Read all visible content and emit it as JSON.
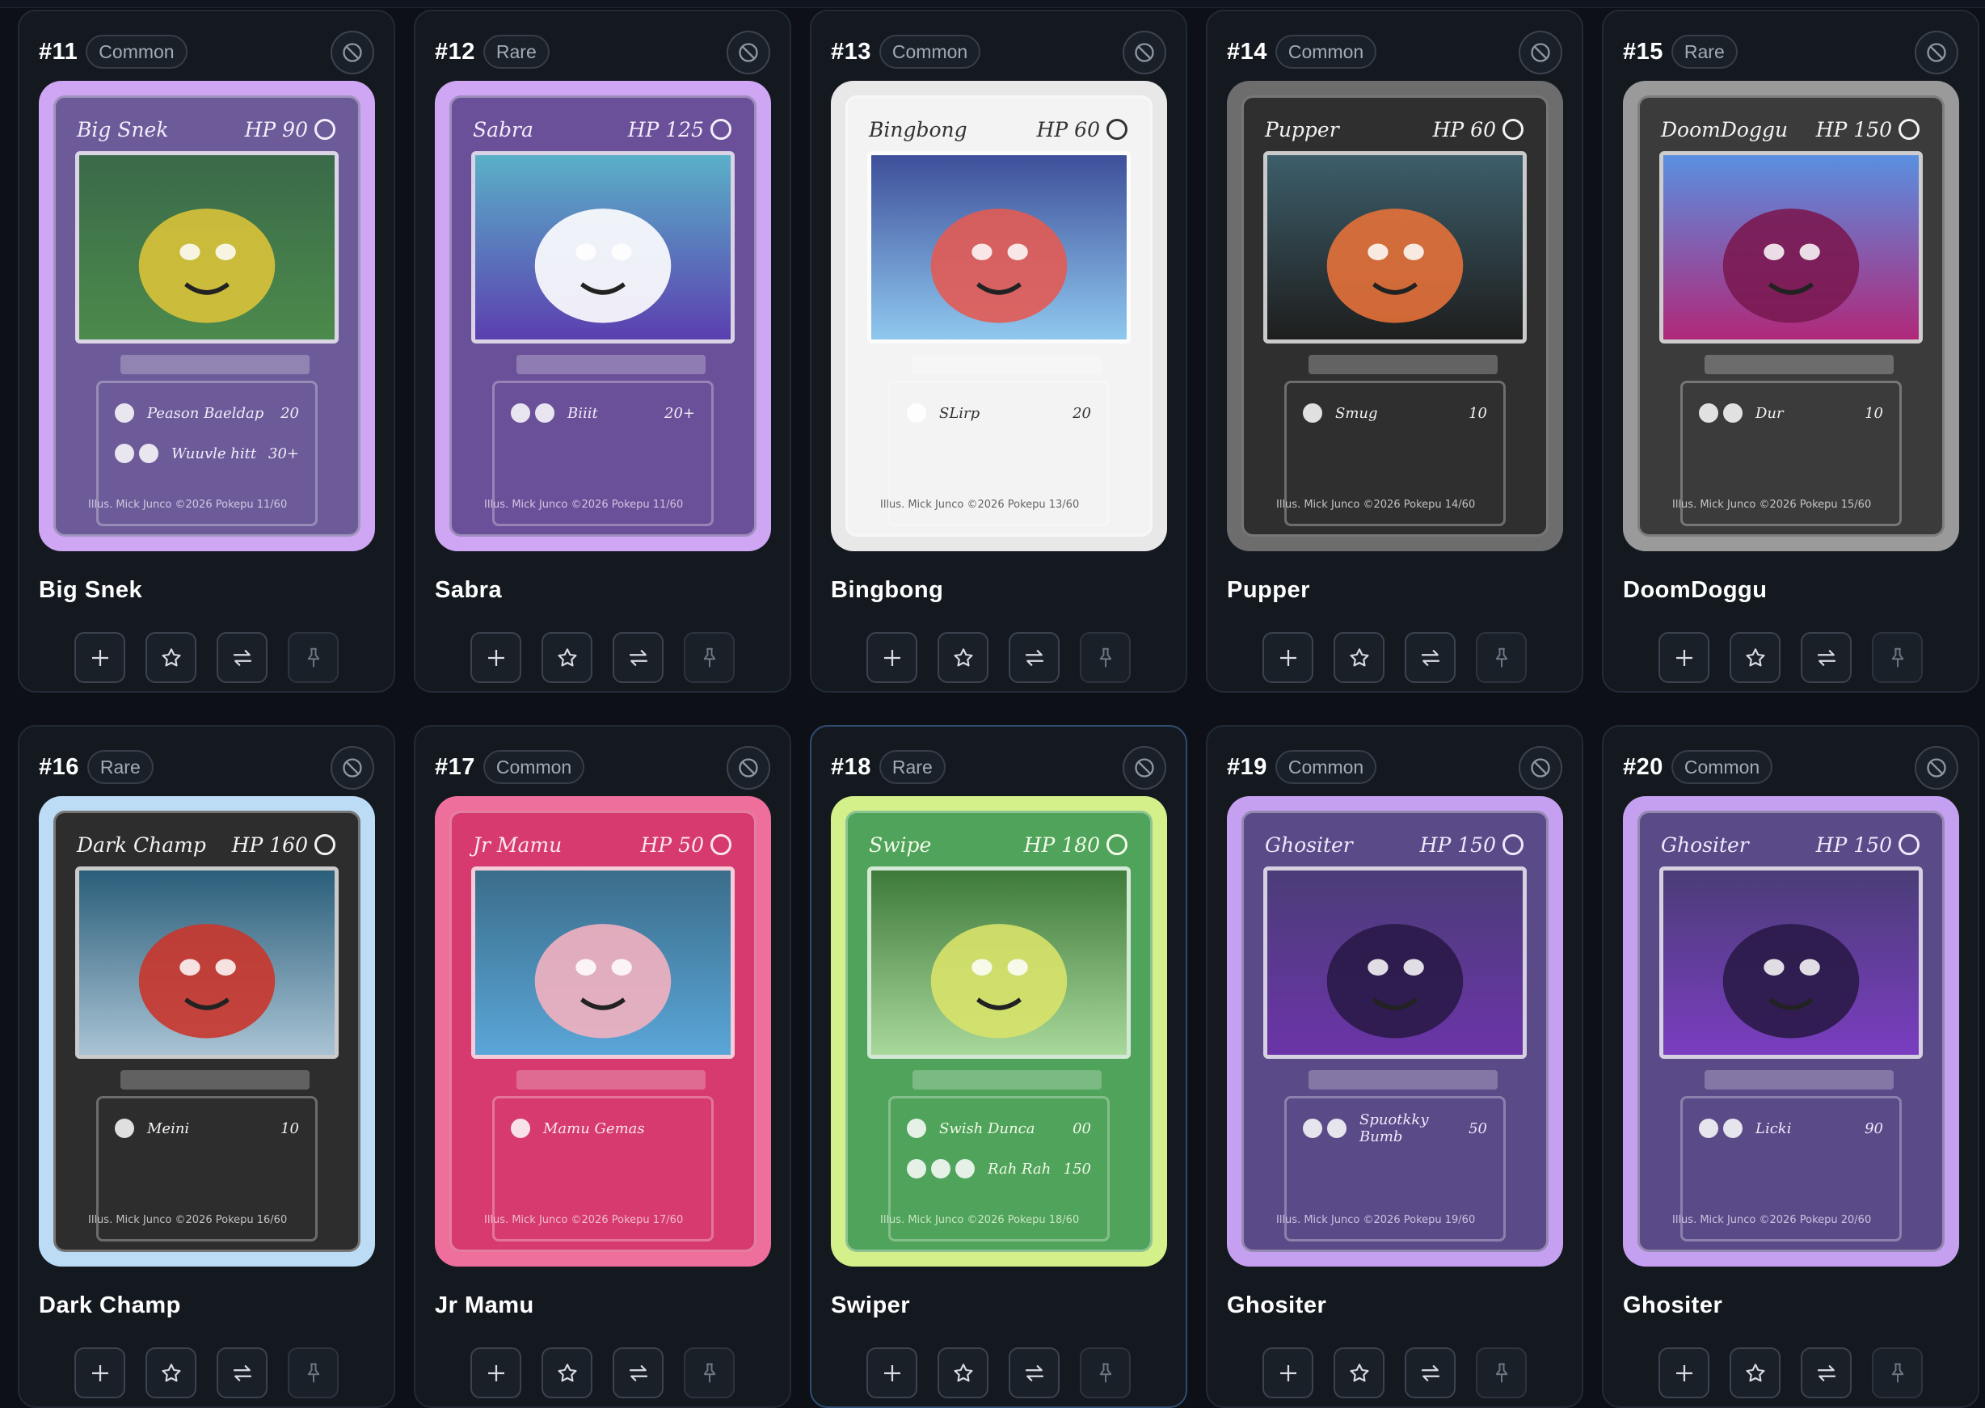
{
  "cards": [
    {
      "number": "#11",
      "rarity": "Common",
      "name": "Big Snek",
      "card_title": "Big Snek",
      "hp": "HP 90",
      "frame_color": "#cfa6f4",
      "panel_color": "#6c5b98",
      "text_color": "#f2ecfb",
      "art_colors": [
        "#3a6a4a",
        "#4c8a4b",
        "#d9c23a"
      ],
      "moves": [
        {
          "name": "Peason Baeldap",
          "damage": "20",
          "cost": 1
        },
        {
          "name": "Wuuvle hitt",
          "damage": "30+",
          "cost": 2
        }
      ],
      "footer": "Illus. Mick Junco  ©2026 Pokepu  11/60"
    },
    {
      "number": "#12",
      "rarity": "Rare",
      "name": "Sabra",
      "card_title": "Sabra",
      "hp": "HP 125",
      "frame_color": "#cfa6f4",
      "panel_color": "#6a5098",
      "text_color": "#f2ecfb",
      "art_colors": [
        "#5ab0c8",
        "#5b3fb0",
        "#ffffff"
      ],
      "moves": [
        {
          "name": "Biiit",
          "damage": "20+",
          "cost": 2
        }
      ],
      "footer": "Illus. Mick Junco  ©2026 Pokepu  11/60"
    },
    {
      "number": "#13",
      "rarity": "Common",
      "name": "Bingbong",
      "card_title": "Bingbong",
      "hp": "HP 60",
      "frame_color": "#e8e8e8",
      "panel_color": "#f3f3f3",
      "text_color": "#333333",
      "art_colors": [
        "#3e4f9a",
        "#8fc8ef",
        "#e25b54"
      ],
      "moves": [
        {
          "name": "SLirp",
          "damage": "20",
          "cost": 1
        }
      ],
      "footer": "Illus. Mick Junco  ©2026 Pokepu  13/60"
    },
    {
      "number": "#14",
      "rarity": "Common",
      "name": "Pupper",
      "card_title": "Pupper",
      "hp": "HP 60",
      "frame_color": "#6d6d6d",
      "panel_color": "#2f2f2f",
      "text_color": "#f2f2f2",
      "art_colors": [
        "#3c5e6a",
        "#1e1e1e",
        "#e4713a"
      ],
      "moves": [
        {
          "name": "Smug",
          "damage": "10",
          "cost": 1
        }
      ],
      "footer": "Illus. Mick Junco  ©2026 Pokepu  14/60"
    },
    {
      "number": "#15",
      "rarity": "Rare",
      "name": "DoomDoggu",
      "card_title": "DoomDoggu",
      "hp": "HP 150",
      "frame_color": "#9a9a9a",
      "panel_color": "#3b3b3b",
      "text_color": "#f2f2f2",
      "art_colors": [
        "#5a8fe0",
        "#b0287a",
        "#7a1a52"
      ],
      "moves": [
        {
          "name": "Dur",
          "damage": "10",
          "cost": 2
        }
      ],
      "footer": "Illus. Mick Junco  ©2026 Pokepu  15/60"
    },
    {
      "number": "#16",
      "rarity": "Rare",
      "name": "Dark Champ",
      "card_title": "Dark Champ",
      "hp": "HP 160",
      "frame_color": "#bcdcf6",
      "panel_color": "#2d2d2d",
      "text_color": "#f2f2f2",
      "art_colors": [
        "#2a5e7a",
        "#a9c3d4",
        "#c9362c"
      ],
      "moves": [
        {
          "name": "Meini",
          "damage": "10",
          "cost": 1
        }
      ],
      "footer": "Illus. Mick Junco  ©2026 Pokepu  16/60"
    },
    {
      "number": "#17",
      "rarity": "Common",
      "name": "Jr Mamu",
      "card_title": "Jr Mamu",
      "hp": "HP 50",
      "frame_color": "#ef6f9c",
      "panel_color": "#d63a6e",
      "text_color": "#fbe6ee",
      "art_colors": [
        "#3b6d8a",
        "#5aa6d8",
        "#f2b1c0"
      ],
      "moves": [
        {
          "name": "Mamu Gemas",
          "damage": "",
          "cost": 1
        }
      ],
      "footer": "Illus. Mick Junco  ©2026 Pokepu  17/60"
    },
    {
      "number": "#18",
      "rarity": "Rare",
      "name": "Swiper",
      "card_title": "Swipe",
      "hp": "HP 180",
      "frame_color": "#d4f08a",
      "panel_color": "#4fa35a",
      "text_color": "#f2fbe8",
      "art_colors": [
        "#3e7a3a",
        "#a8d89a",
        "#d8e26a"
      ],
      "moves": [
        {
          "name": "Swish Dunca",
          "damage": "00",
          "cost": 1
        },
        {
          "name": "Rah Rah",
          "damage": "150",
          "cost": 3
        }
      ],
      "footer": "Illus. Mick Junco  ©2026 Pokepu  18/60"
    },
    {
      "number": "#19",
      "rarity": "Common",
      "name": "Ghositer",
      "card_title": "Ghositer",
      "hp": "HP 150",
      "frame_color": "#c6a0f0",
      "panel_color": "#5b4a88",
      "text_color": "#efe8fb",
      "art_colors": [
        "#4b3d78",
        "#6b34a8",
        "#2a1a48"
      ],
      "moves": [
        {
          "name": "Spuotkky Bumb",
          "damage": "50",
          "cost": 2
        }
      ],
      "footer": "Illus. Mick Junco  ©2026 Pokepu  19/60"
    },
    {
      "number": "#20",
      "rarity": "Common",
      "name": "Ghositer",
      "card_title": "Ghositer",
      "hp": "HP 150",
      "frame_color": "#c6a0f0",
      "panel_color": "#5b4a88",
      "text_color": "#efe8fb",
      "art_colors": [
        "#4b3d78",
        "#7a3dc0",
        "#2a1a48"
      ],
      "moves": [
        {
          "name": "Licki",
          "damage": "90",
          "cost": 2
        }
      ],
      "footer": "Illus. Mick Junco  ©2026 Pokepu  20/60"
    }
  ],
  "selected_card": "#18",
  "icons": {
    "hide": "slash-circle-icon",
    "add": "plus-icon",
    "favorite": "star-icon",
    "trade": "swap-arrows-icon",
    "pin": "pin-icon"
  }
}
